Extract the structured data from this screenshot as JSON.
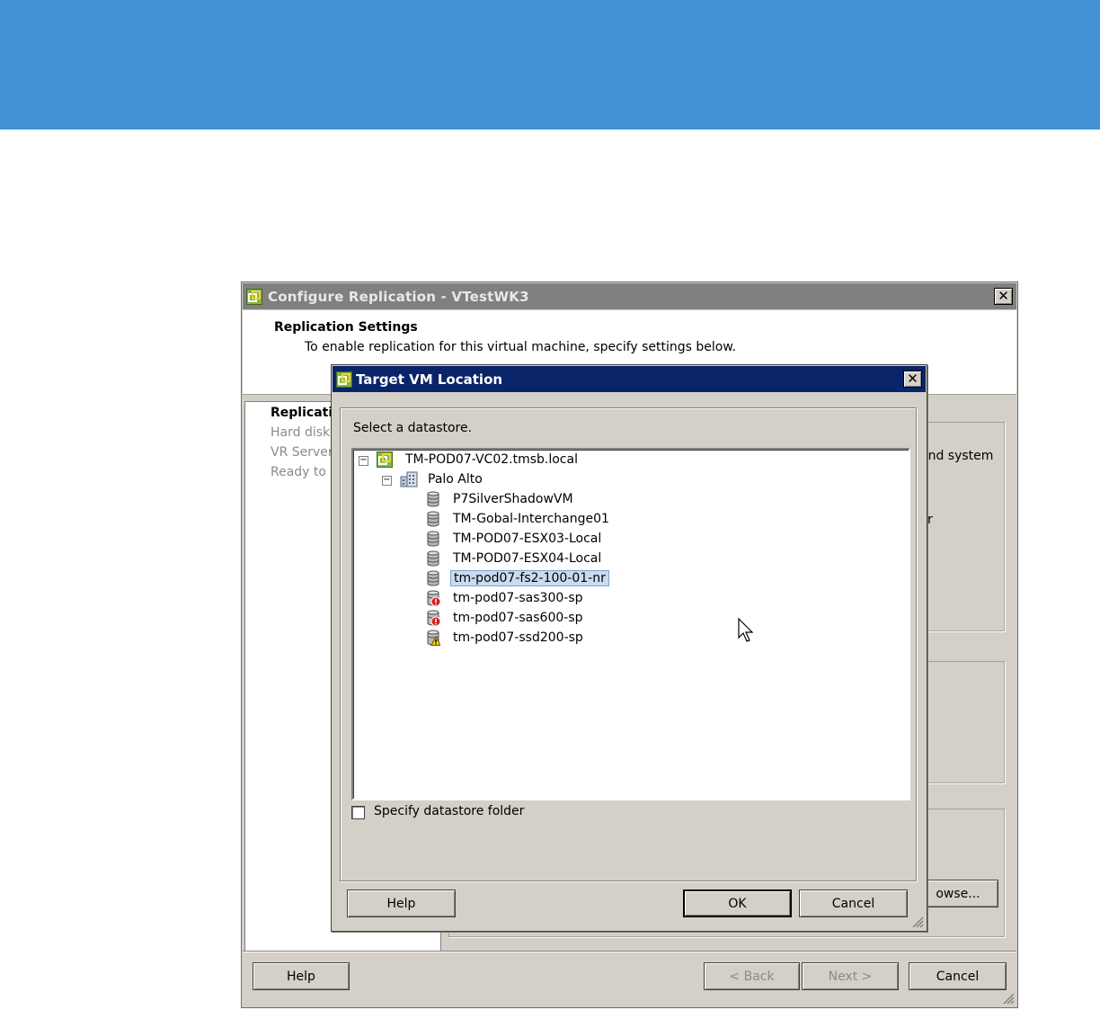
{
  "outer_dialog": {
    "title": "Configure Replication - VTestWK3",
    "close_glyph": "✕",
    "header_title": "Replication Settings",
    "header_subtitle": "To enable replication for this virtual machine, specify settings below.",
    "steps": [
      {
        "label": "Replicati",
        "active": true
      },
      {
        "label": "Hard disk",
        "active": false
      },
      {
        "label": "VR Server",
        "active": false
      },
      {
        "label": "Ready to c",
        "active": false
      }
    ],
    "right_fragments": {
      "system_text": "and system",
      "r_text": "r",
      "browse_button": "owse..."
    },
    "buttons": {
      "help": "Help",
      "back": "< Back",
      "next": "Next >",
      "cancel": "Cancel"
    }
  },
  "inner_dialog": {
    "title": "Target VM Location",
    "close_glyph": "✕",
    "prompt": "Select a datastore.",
    "tree": {
      "root": {
        "label": "TM-POD07-VC02.tmsb.local",
        "icon": "vcenter-icon",
        "expanded": true
      },
      "datacenter": {
        "label": "Palo Alto",
        "icon": "datacenter-icon",
        "expanded": true
      },
      "datastores": [
        {
          "label": "P7SilverShadowVM",
          "status": "normal"
        },
        {
          "label": "TM-Gobal-Interchange01",
          "status": "normal"
        },
        {
          "label": "TM-POD07-ESX03-Local",
          "status": "normal"
        },
        {
          "label": "TM-POD07-ESX04-Local",
          "status": "normal"
        },
        {
          "label": "tm-pod07-fs2-100-01-nr",
          "status": "normal",
          "selected": true
        },
        {
          "label": "tm-pod07-sas300-sp",
          "status": "error"
        },
        {
          "label": "tm-pod07-sas600-sp",
          "status": "error"
        },
        {
          "label": "tm-pod07-ssd200-sp",
          "status": "warning"
        }
      ]
    },
    "checkbox": {
      "label": "Specify datastore folder",
      "checked": false
    },
    "buttons": {
      "help": "Help",
      "ok": "OK",
      "cancel": "Cancel"
    }
  },
  "colors": {
    "banner": "#4193d5",
    "active_title": "#0a246a",
    "inactive_title": "#808080",
    "selection": "#c8dcef"
  }
}
